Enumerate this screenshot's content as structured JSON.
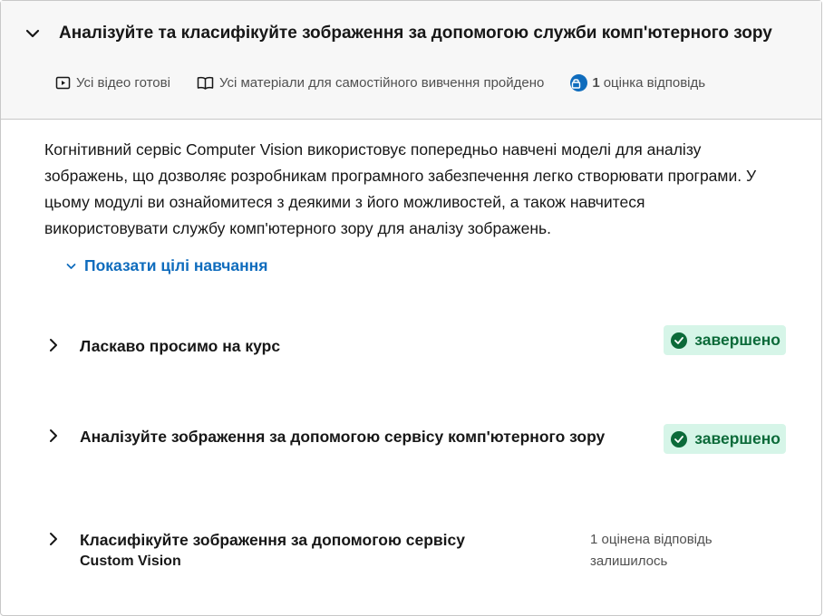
{
  "module": {
    "title": "Аналізуйте та класифікуйте зображення за допомогою служби комп'ютерного зору",
    "meta": {
      "videos": "Усі відео готові",
      "materials": "Усі матеріали для самостійного вивчення пройдено",
      "assessment_count": "1",
      "assessment_label": "оцінка відповідь"
    },
    "description": "Когнітивний сервіс Computer Vision використовує попередньо навчені моделі для аналізу зображень, що дозволяє розробникам програмного забезпечення легко створювати програми. У цьому модулі ви ознайомитеся з деякими з його можливостей, а також навчитеся використовувати службу комп'ютерного зору для аналізу зображень.",
    "show_goals_label": "Показати цілі навчання"
  },
  "units": [
    {
      "title": "Ласкаво просимо на курс",
      "status": "завершено"
    },
    {
      "title": "Аналізуйте зображення за допомогою сервісу комп'ютерного зору",
      "status": "завершено"
    },
    {
      "title": "Класифікуйте зображення за допомогою сервісу",
      "subtitle": "Custom Vision",
      "status_line1": "1 оцінена відповідь",
      "status_line2": "залишилось"
    }
  ],
  "colors": {
    "accent": "#0f6cbd",
    "success_bg": "#d6f5e8",
    "success_text": "#0b6a39"
  }
}
